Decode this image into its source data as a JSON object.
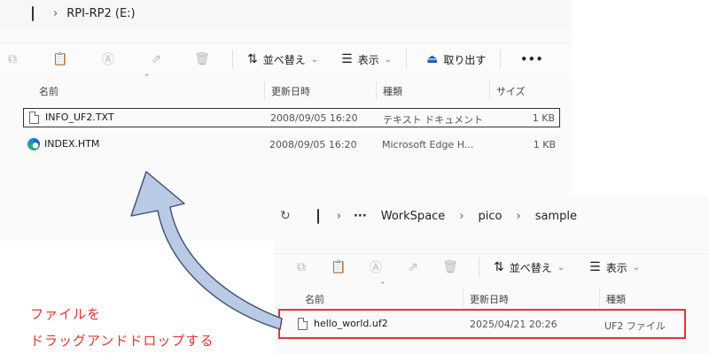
{
  "window1": {
    "address": {
      "path": [
        "RPI-RP2 (E:)"
      ]
    },
    "toolbar": {
      "sort_label": "並べ替え",
      "view_label": "表示",
      "eject_label": "取り出す",
      "more_label": "•••"
    },
    "columns": [
      "名前",
      "更新日時",
      "種類",
      "サイズ"
    ],
    "files": [
      {
        "name": "INFO_UF2.TXT",
        "date": "2008/09/05 16:20",
        "type": "テキスト ドキュメント",
        "size": "1 KB",
        "icon": "text-file-icon"
      },
      {
        "name": "INDEX.HTM",
        "date": "2008/09/05 16:20",
        "type": "Microsoft Edge H...",
        "size": "1 KB",
        "icon": "edge-icon"
      }
    ]
  },
  "window2": {
    "address": {
      "ellipsis": "···",
      "path": [
        "WorkSpace",
        "pico",
        "sample"
      ]
    },
    "toolbar": {
      "sort_label": "並べ替え",
      "view_label": "表示"
    },
    "columns": [
      "名前",
      "更新日時",
      "種類"
    ],
    "files": [
      {
        "name": "hello_world.uf2",
        "date": "2025/04/21 20:26",
        "type": "UF2 ファイル",
        "icon": "file-icon"
      }
    ]
  },
  "caption": {
    "line1": "ファイルを",
    "line2": "ドラッグアンドドロップする"
  },
  "colors": {
    "highlight_red": "#e8342c",
    "arrow_fill": "#b9cbe4",
    "arrow_stroke": "#3e4e72"
  }
}
